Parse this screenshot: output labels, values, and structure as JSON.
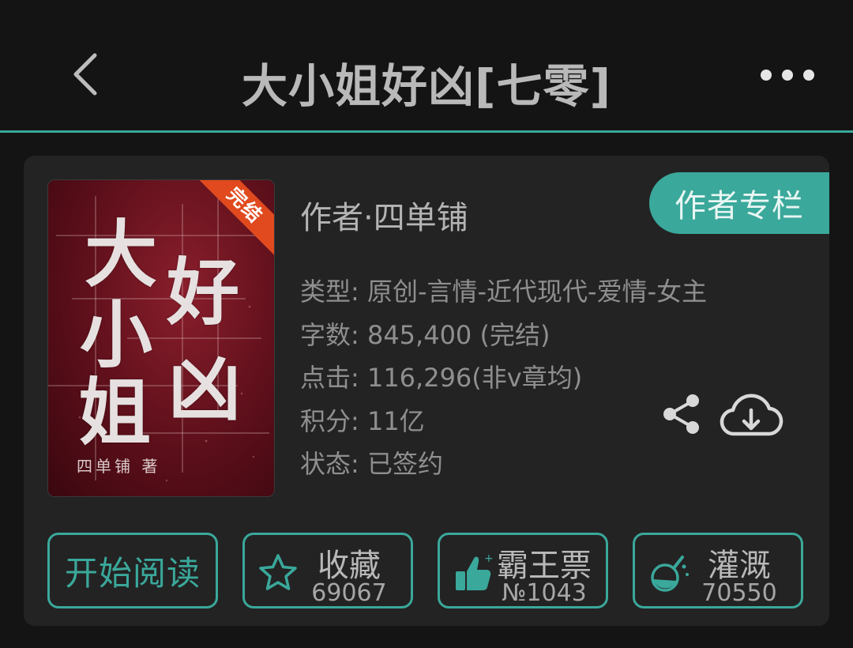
{
  "header": {
    "title": "大小姐好凶[七零]"
  },
  "book": {
    "cover": {
      "title_chars": [
        "大",
        "小",
        "姐",
        "好",
        "凶"
      ],
      "author_text": "四单铺 著",
      "badge": "完结"
    },
    "author_line": "作者·四单铺",
    "author_column_button": "作者专栏",
    "meta": {
      "genre": "类型: 原创-言情-近代现代-爱情-女主",
      "word_count": "字数: 845,400 (完结)",
      "clicks": "点击: 116,296(非v章均)",
      "points": "积分: 11亿",
      "status": "状态: 已签约"
    }
  },
  "actions": {
    "read": {
      "label": "开始阅读"
    },
    "favorite": {
      "label": "收藏",
      "count": "69067",
      "icon": "star-icon"
    },
    "overlord_ticket": {
      "label": "霸王票",
      "count": "№1043",
      "icon": "thumbs-up-icon"
    },
    "nutrient": {
      "label": "灌溉",
      "count": "70550",
      "icon": "flask-icon"
    }
  },
  "icons": {
    "back": "chevron-left-icon",
    "more": "more-dots-icon",
    "share": "share-icon",
    "download": "cloud-download-icon"
  },
  "colors": {
    "accent": "#3aa89b",
    "background": "#141414",
    "card": "#232323",
    "badge": "#e04a1e"
  }
}
